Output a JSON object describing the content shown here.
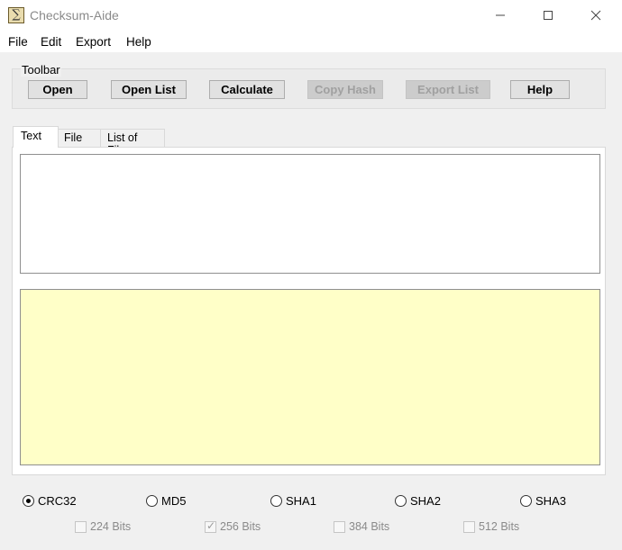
{
  "window": {
    "title": "Checksum-Aide",
    "app_icon_glyph": "∑",
    "icon_names": {
      "app": "checksum-app-icon",
      "minimize": "minimize-icon",
      "maximize": "maximize-icon",
      "close": "close-icon"
    }
  },
  "menu": [
    "File",
    "Edit",
    "Export",
    "Help"
  ],
  "toolbar": {
    "legend": "Toolbar",
    "buttons": [
      {
        "label": "Open",
        "enabled": true
      },
      {
        "label": "Open List",
        "enabled": true
      },
      {
        "label": "Calculate",
        "enabled": true
      },
      {
        "label": "Copy Hash",
        "enabled": false
      },
      {
        "label": "Export List",
        "enabled": false
      },
      {
        "label": "Help",
        "enabled": true
      }
    ]
  },
  "tabs": [
    {
      "label": "Text",
      "active": true
    },
    {
      "label": "File",
      "active": false
    },
    {
      "label": "List of Files",
      "active": false
    }
  ],
  "text_input": {
    "value": ""
  },
  "hash_output": {
    "value": "",
    "background_color": "#ffffc8"
  },
  "algorithms": [
    {
      "label": "CRC32",
      "selected": true
    },
    {
      "label": "MD5",
      "selected": false
    },
    {
      "label": "SHA1",
      "selected": false
    },
    {
      "label": "SHA2",
      "selected": false
    },
    {
      "label": "SHA3",
      "selected": false
    }
  ],
  "bit_lengths": [
    {
      "label": "224 Bits",
      "checked": false,
      "enabled": false
    },
    {
      "label": "256 Bits",
      "checked": true,
      "enabled": false
    },
    {
      "label": "384 Bits",
      "checked": false,
      "enabled": false
    },
    {
      "label": "512 Bits",
      "checked": false,
      "enabled": false
    }
  ]
}
